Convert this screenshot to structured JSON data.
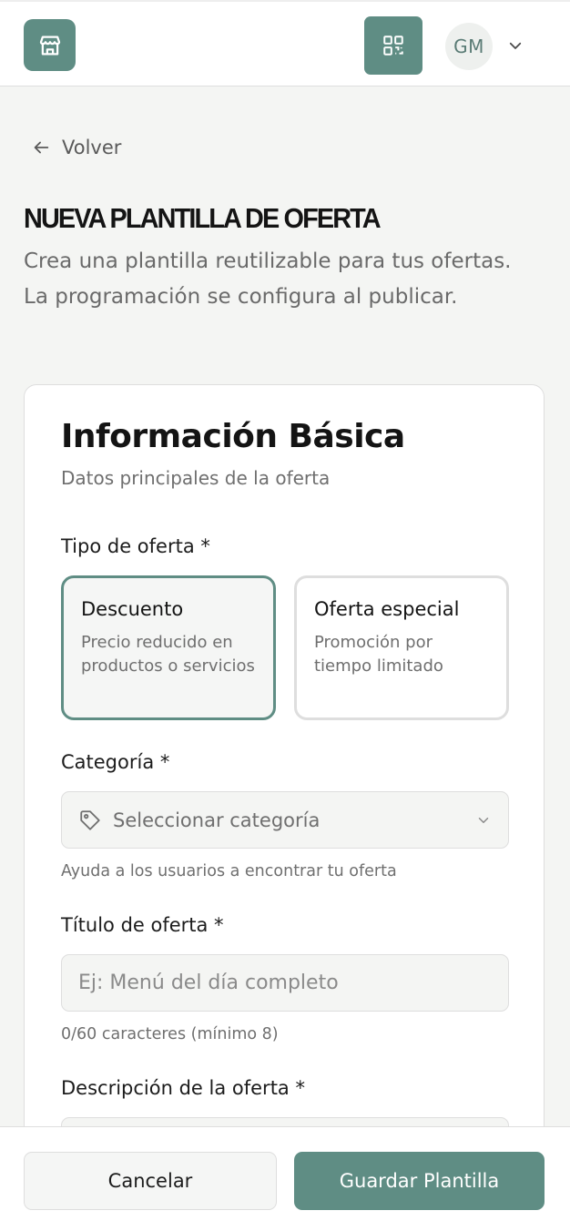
{
  "header": {
    "avatar_initials": "GM",
    "icons": {
      "logo": "store-icon",
      "qr": "qr-code-icon",
      "menu": "chevron-down-icon"
    }
  },
  "nav": {
    "back_label": "Volver"
  },
  "page": {
    "title": "NUEVA PLANTILLA DE OFERTA",
    "subtitle": "Crea una plantilla reutilizable para tus ofertas. La programación se configura al publicar."
  },
  "card": {
    "title": "Información Básica",
    "subtitle": "Datos principales de la oferta",
    "offer_type": {
      "label": "Tipo de oferta *",
      "options": [
        {
          "title": "Descuento",
          "description": "Precio reducido en productos o servicios",
          "selected": true
        },
        {
          "title": "Oferta especial",
          "description": "Promoción por tiempo limitado",
          "selected": false
        }
      ]
    },
    "category": {
      "label": "Categoría *",
      "placeholder": "Seleccionar categoría",
      "helper": "Ayuda a los usuarios a encontrar tu oferta"
    },
    "offer_title": {
      "label": "Título de oferta *",
      "placeholder": "Ej: Menú del día completo",
      "value": "",
      "counter": "0/60 caracteres (mínimo 8)"
    },
    "description": {
      "label": "Descripción de la oferta *"
    }
  },
  "footer": {
    "cancel_label": "Cancelar",
    "save_label": "Guardar Plantilla"
  },
  "colors": {
    "accent": "#5f8d84",
    "background": "#f4f5f3",
    "surface": "#ffffff",
    "border": "#dedede",
    "muted_text": "#6f6f6f"
  }
}
